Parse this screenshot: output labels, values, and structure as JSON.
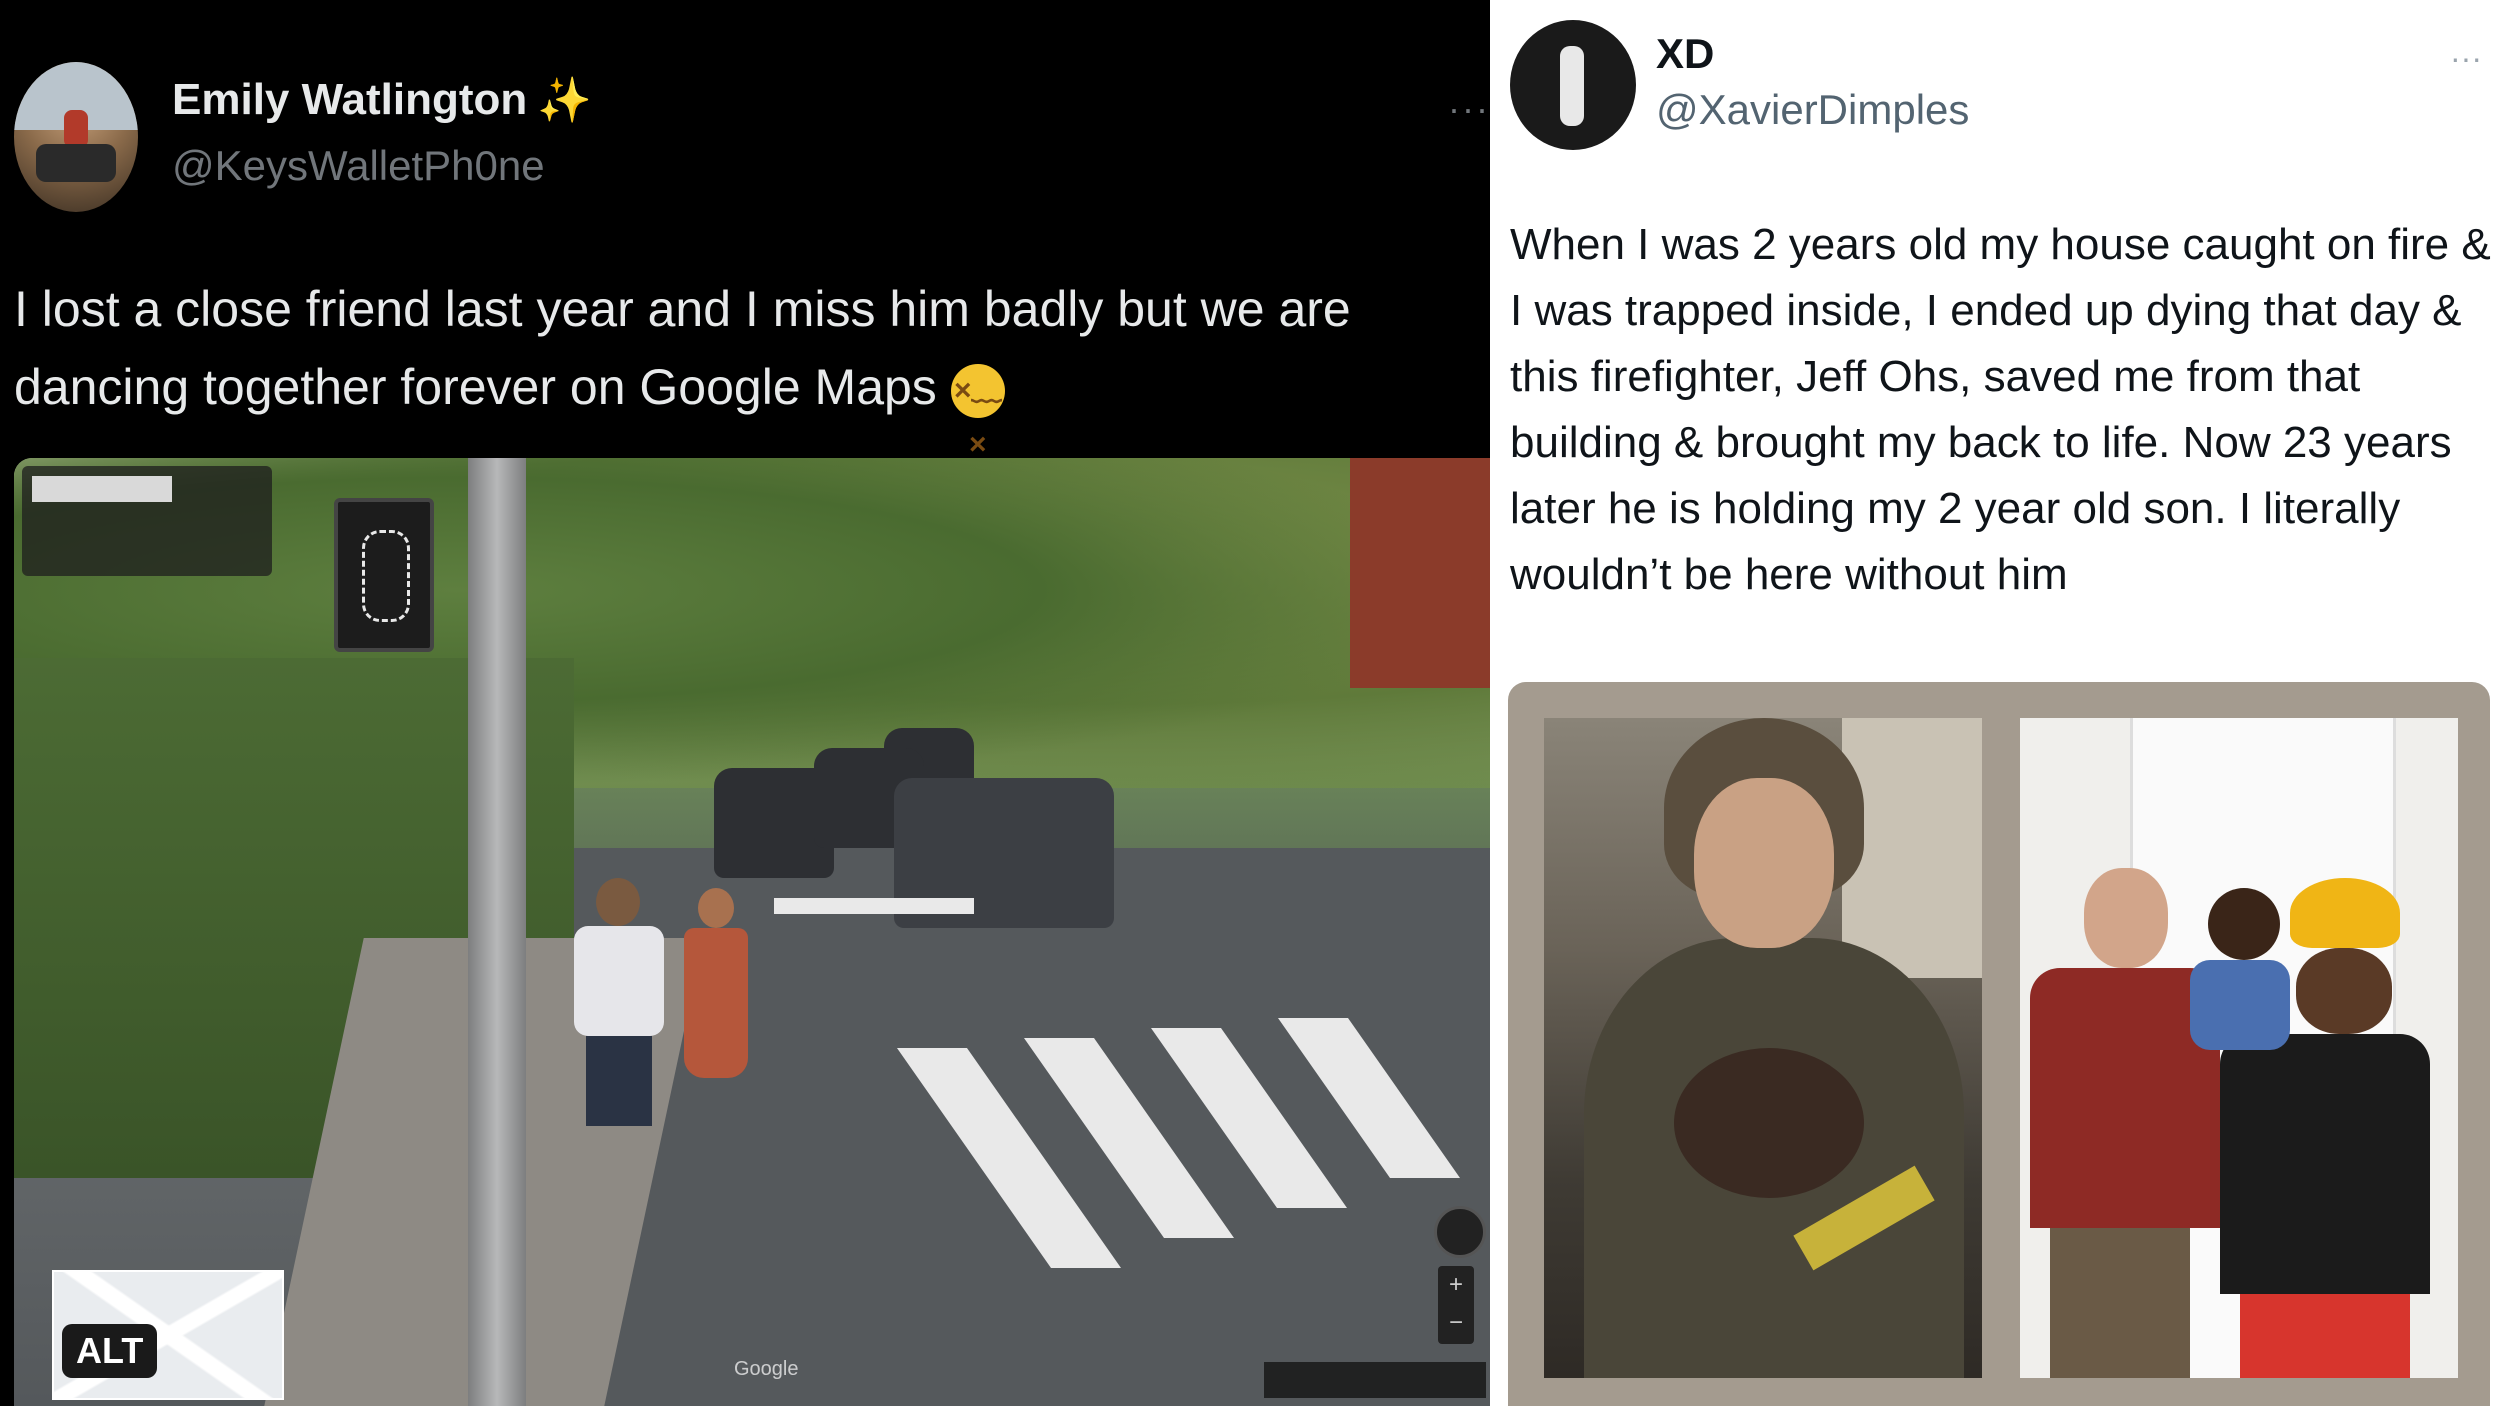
{
  "left_tweet": {
    "display_name": "Emily Watlington",
    "handle": "@KeysWalletPh0ne",
    "more": "···",
    "text": "I lost a close friend last year and I miss him badly but we are dancing together forever on Google Maps",
    "emoji": "😫",
    "media": {
      "alt_badge": "ALT",
      "watermark": "Google"
    }
  },
  "right_tweet": {
    "display_name": "XD",
    "handle": "@XavierDimples",
    "more": "···",
    "text": "When I was 2 years old my house caught on fire & I was trapped inside, I ended up dying that day & this firefighter, Jeff Ohs, saved me from that building & brought my back to life. Now 23 years later he is holding my 2 year old son. I literally wouldn’t be here without him"
  },
  "colors": {
    "dark_bg": "#000000",
    "dark_text": "#e7e9ea",
    "dark_handle": "#71767b",
    "light_bg": "#ffffff",
    "light_text": "#0f1419",
    "light_handle": "#536471",
    "sparkle": "#f5c518"
  }
}
